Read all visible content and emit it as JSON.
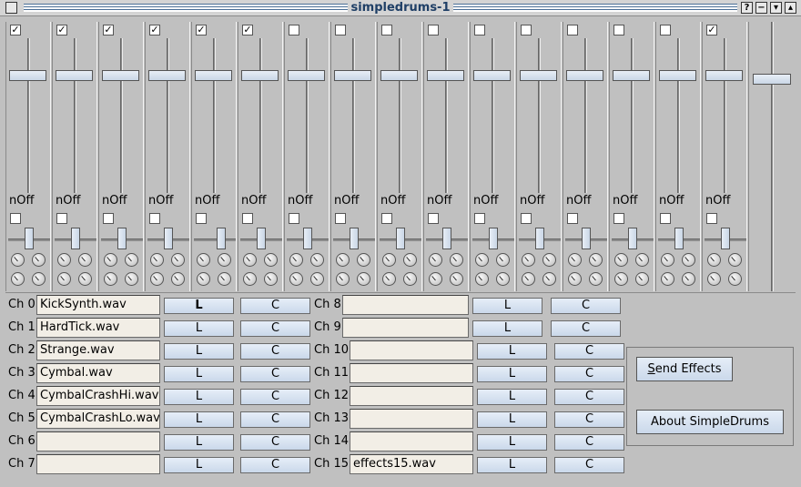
{
  "window": {
    "title": "simpledrums-1"
  },
  "titlebar_buttons": [
    "?",
    "−",
    "▾",
    "▴"
  ],
  "mixer": {
    "strips": [
      {
        "enabled": true,
        "noff_label": "nOff",
        "noff_checked": false
      },
      {
        "enabled": true,
        "noff_label": "nOff",
        "noff_checked": false
      },
      {
        "enabled": true,
        "noff_label": "nOff",
        "noff_checked": false
      },
      {
        "enabled": true,
        "noff_label": "nOff",
        "noff_checked": false
      },
      {
        "enabled": true,
        "noff_label": "nOff",
        "noff_checked": false
      },
      {
        "enabled": true,
        "noff_label": "nOff",
        "noff_checked": false
      },
      {
        "enabled": false,
        "noff_label": "nOff",
        "noff_checked": false
      },
      {
        "enabled": false,
        "noff_label": "nOff",
        "noff_checked": false
      },
      {
        "enabled": false,
        "noff_label": "nOff",
        "noff_checked": false
      },
      {
        "enabled": false,
        "noff_label": "nOff",
        "noff_checked": false
      },
      {
        "enabled": false,
        "noff_label": "nOff",
        "noff_checked": false
      },
      {
        "enabled": false,
        "noff_label": "nOff",
        "noff_checked": false
      },
      {
        "enabled": false,
        "noff_label": "nOff",
        "noff_checked": false
      },
      {
        "enabled": false,
        "noff_label": "nOff",
        "noff_checked": false
      },
      {
        "enabled": false,
        "noff_label": "nOff",
        "noff_checked": false
      },
      {
        "enabled": true,
        "noff_label": "nOff",
        "noff_checked": false
      }
    ],
    "pan_levels": [
      0.5,
      0.5,
      0.5,
      0.5,
      0.7,
      0.5,
      0.5,
      0.5,
      0.5,
      0.5,
      0.5,
      0.5,
      0.5,
      0.5,
      0.5,
      0.5
    ]
  },
  "channels": [
    {
      "label": "Ch 0",
      "file": "KickSynth.wav",
      "load": "L",
      "clear": "C",
      "load_bold": true
    },
    {
      "label": "Ch 1",
      "file": "HardTick.wav",
      "load": "L",
      "clear": "C"
    },
    {
      "label": "Ch 2",
      "file": "Strange.wav",
      "load": "L",
      "clear": "C"
    },
    {
      "label": "Ch 3",
      "file": "Cymbal.wav",
      "load": "L",
      "clear": "C"
    },
    {
      "label": "Ch 4",
      "file": "CymbalCrashHi.wav",
      "load": "L",
      "clear": "C"
    },
    {
      "label": "Ch 5",
      "file": "CymbalCrashLo.wav",
      "load": "L",
      "clear": "C"
    },
    {
      "label": "Ch 6",
      "file": "",
      "load": "L",
      "clear": "C"
    },
    {
      "label": "Ch 7",
      "file": "",
      "load": "L",
      "clear": "C"
    },
    {
      "label": "Ch 8",
      "file": "",
      "load": "L",
      "clear": "C"
    },
    {
      "label": "Ch 9",
      "file": "",
      "load": "L",
      "clear": "C"
    },
    {
      "label": "Ch 10",
      "file": "",
      "load": "L",
      "clear": "C"
    },
    {
      "label": "Ch 11",
      "file": "",
      "load": "L",
      "clear": "C"
    },
    {
      "label": "Ch 12",
      "file": "",
      "load": "L",
      "clear": "C"
    },
    {
      "label": "Ch 13",
      "file": "",
      "load": "L",
      "clear": "C"
    },
    {
      "label": "Ch 14",
      "file": "",
      "load": "L",
      "clear": "C"
    },
    {
      "label": "Ch 15",
      "file": "effects15.wav",
      "load": "L",
      "clear": "C"
    }
  ],
  "effects": {
    "send_effects_label": "Send Effects",
    "about_label": "About SimpleDrums"
  }
}
